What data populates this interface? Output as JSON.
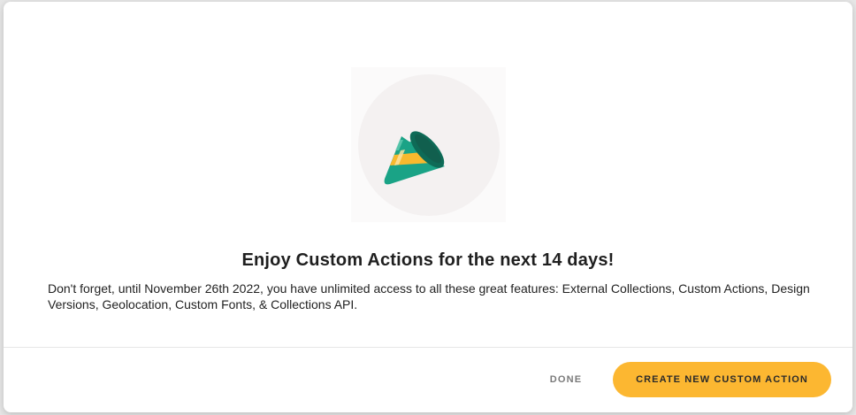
{
  "modal": {
    "illustration_icon": "party-hat-icon",
    "title": "Enjoy Custom Actions for the next 14 days!",
    "body": "Don't forget, until November 26th 2022, you have unlimited access to all these great features: External Collections, Custom Actions, Design Versions, Geolocation, Custom Fonts, & Collections API."
  },
  "footer": {
    "done_label": "DONE",
    "create_label": "CREATE NEW CUSTOM ACTION"
  },
  "colors": {
    "accent": "#fcb731",
    "hat_teal": "#1aa386",
    "hat_dark": "#0e6b57",
    "hat_stripe": "#f8b92e",
    "circle_bg": "#f4f1f1"
  }
}
